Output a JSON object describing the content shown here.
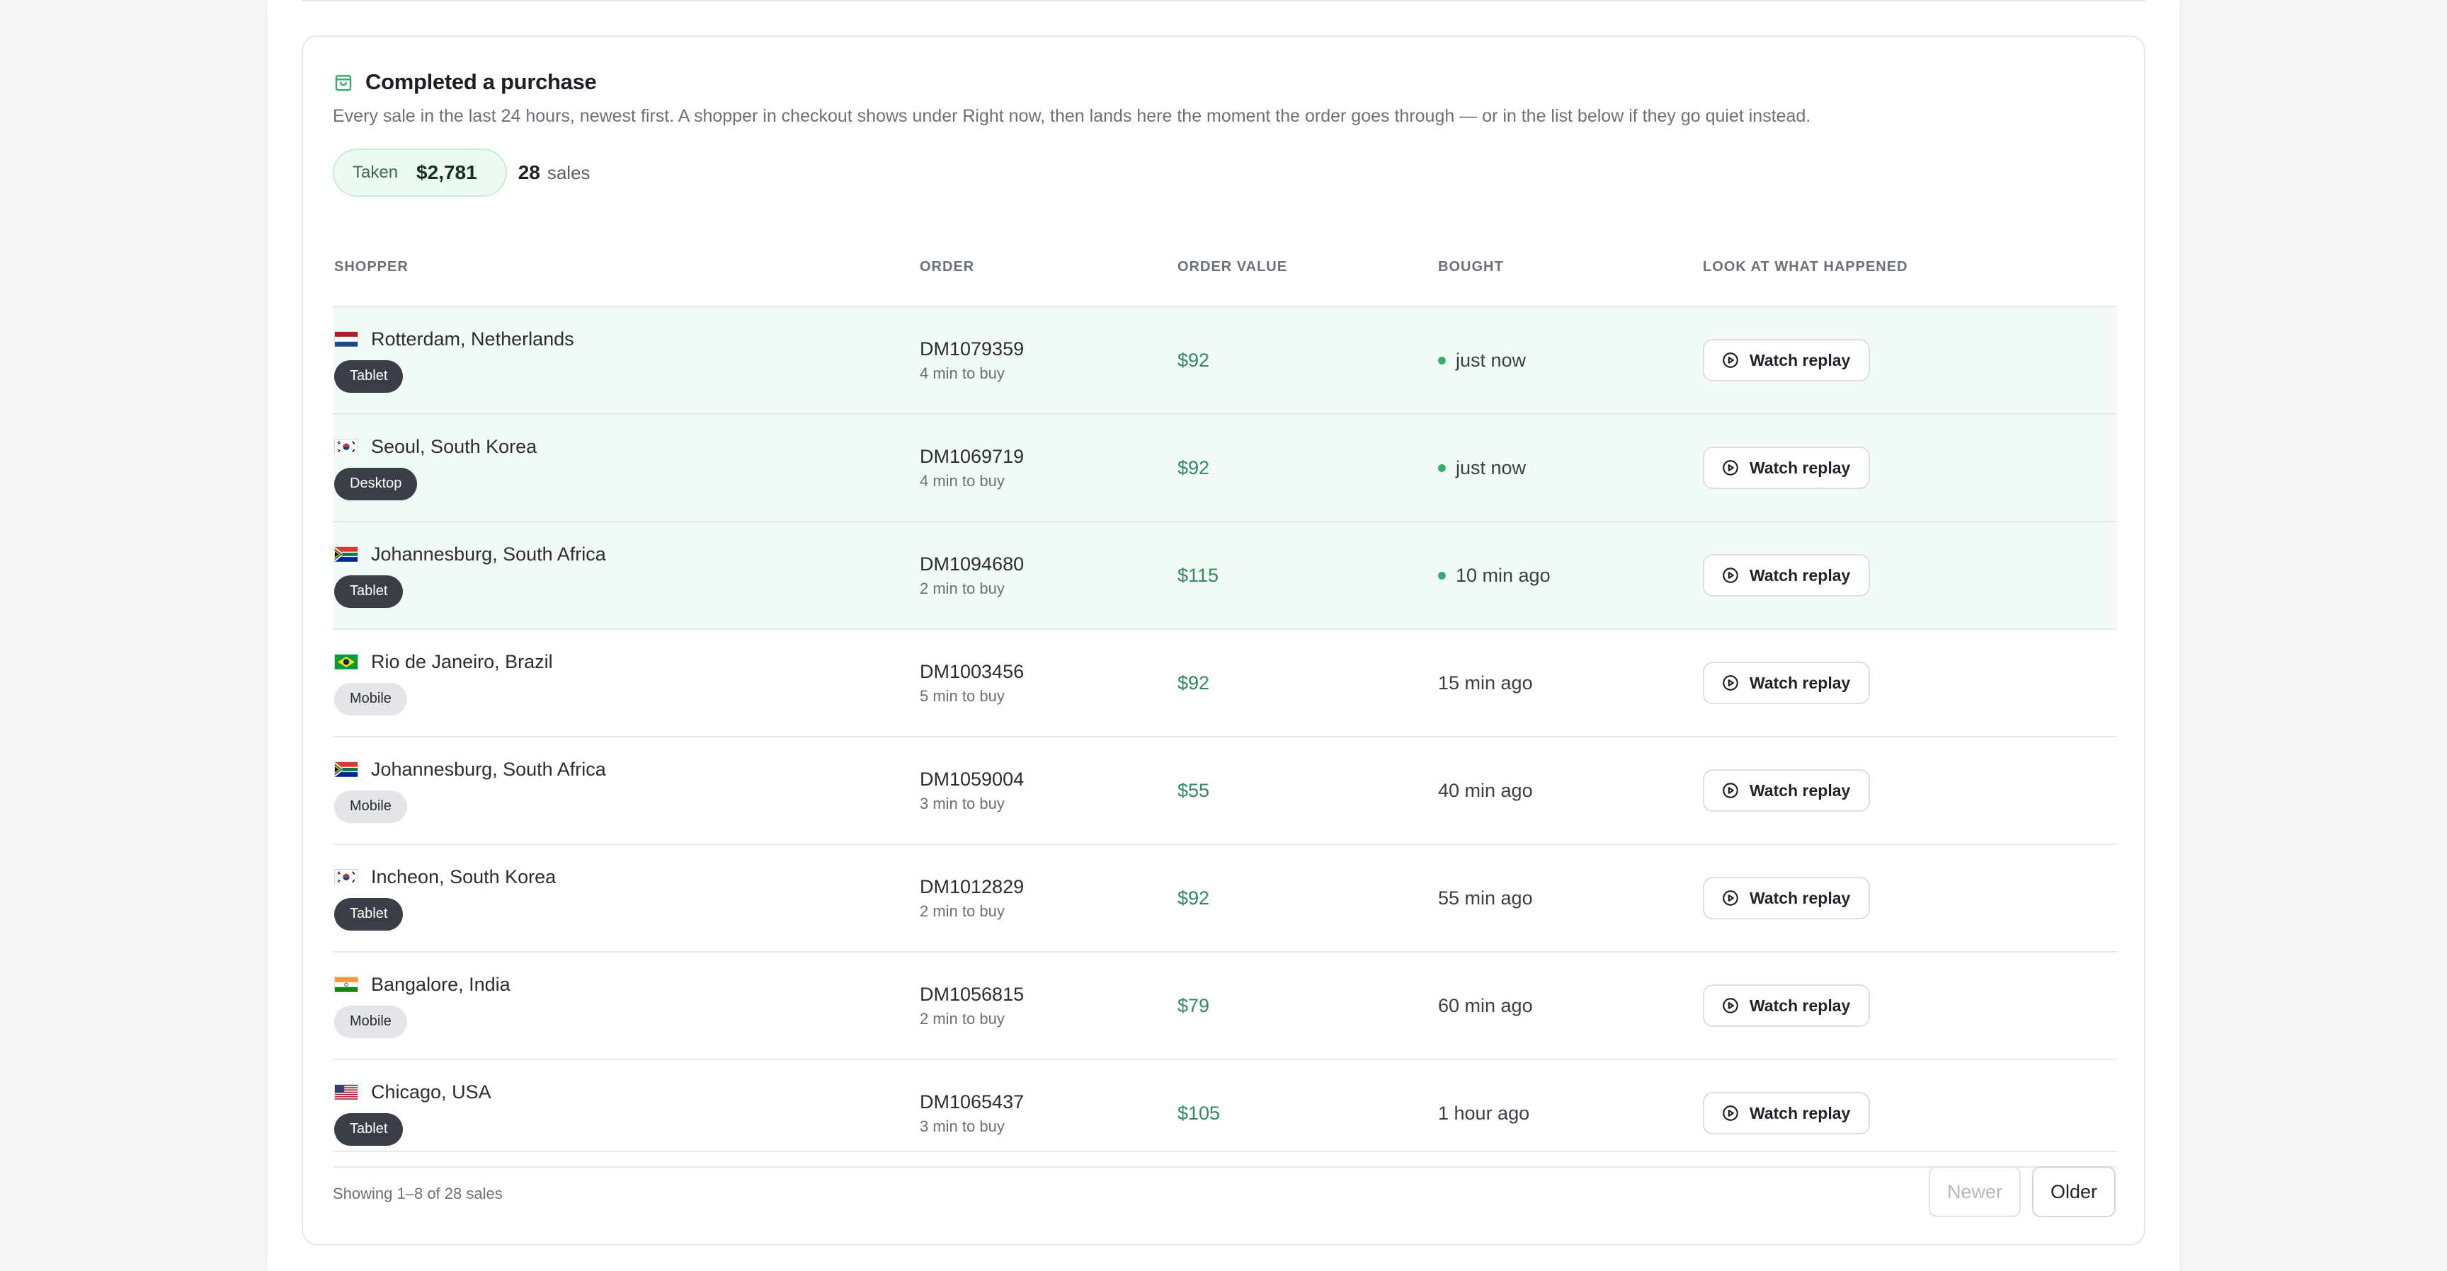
{
  "section": {
    "title": "Completed a purchase",
    "icon": "shopping-bag-icon",
    "subtitle": "Every sale in the last 24 hours, newest first. A shopper in checkout shows under Right now, then lands here the moment the order goes through — or in the list below if they go quiet instead.",
    "taken_label": "Taken",
    "taken_value": "$2,781",
    "sales_count": "28",
    "sales_word": "sales"
  },
  "table": {
    "headers": {
      "shopper": "SHOPPER",
      "order": "ORDER",
      "order_value": "ORDER VALUE",
      "bought": "BOUGHT",
      "action": "LOOK AT WHAT HAPPENED"
    },
    "replay_label": "Watch replay",
    "rows": [
      {
        "location": "Rotterdam, Netherlands",
        "flag": "netherlands",
        "device": "Tablet",
        "order_id": "DM1079359",
        "time_to_buy": "4 min to buy",
        "value": "$92",
        "bought": "just now",
        "recent": true
      },
      {
        "location": "Seoul, South Korea",
        "flag": "south-korea",
        "device": "Desktop",
        "order_id": "DM1069719",
        "time_to_buy": "4 min to buy",
        "value": "$92",
        "bought": "just now",
        "recent": true
      },
      {
        "location": "Johannesburg, South Africa",
        "flag": "south-africa",
        "device": "Tablet",
        "order_id": "DM1094680",
        "time_to_buy": "2 min to buy",
        "value": "$115",
        "bought": "10 min ago",
        "recent": true
      },
      {
        "location": "Rio de Janeiro, Brazil",
        "flag": "brazil",
        "device": "Mobile",
        "order_id": "DM1003456",
        "time_to_buy": "5 min to buy",
        "value": "$92",
        "bought": "15 min ago",
        "recent": false
      },
      {
        "location": "Johannesburg, South Africa",
        "flag": "south-africa",
        "device": "Mobile",
        "order_id": "DM1059004",
        "time_to_buy": "3 min to buy",
        "value": "$55",
        "bought": "40 min ago",
        "recent": false
      },
      {
        "location": "Incheon, South Korea",
        "flag": "south-korea",
        "device": "Tablet",
        "order_id": "DM1012829",
        "time_to_buy": "2 min to buy",
        "value": "$92",
        "bought": "55 min ago",
        "recent": false
      },
      {
        "location": "Bangalore, India",
        "flag": "india",
        "device": "Mobile",
        "order_id": "DM1056815",
        "time_to_buy": "2 min to buy",
        "value": "$79",
        "bought": "60 min ago",
        "recent": false
      },
      {
        "location": "Chicago, USA",
        "flag": "usa",
        "device": "Tablet",
        "order_id": "DM1065437",
        "time_to_buy": "3 min to buy",
        "value": "$105",
        "bought": "1 hour ago",
        "recent": false
      }
    ]
  },
  "footer": {
    "showing": "Showing 1–8 of 28 sales",
    "newer_label": "Newer",
    "older_label": "Older"
  },
  "colors": {
    "accent_green": "#2f8a5c",
    "recent_row_bg": "#f1faf5",
    "live_dot": "#3aae72"
  }
}
